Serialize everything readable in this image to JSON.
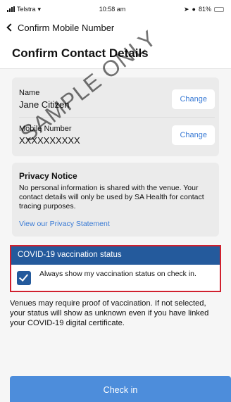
{
  "status_bar": {
    "carrier": "Telstra",
    "time": "10:58 am",
    "battery": "81%",
    "battery_level": 0.81
  },
  "nav": {
    "back_label": "Confirm Mobile Number"
  },
  "header": {
    "title": "Confirm Contact Details"
  },
  "contact": {
    "name_label": "Name",
    "name_value": "Jane Citizen",
    "mobile_label": "Mobile Number",
    "mobile_value": "XXXXXXXXXX",
    "change_label": "Change"
  },
  "privacy": {
    "title": "Privacy Notice",
    "text": "No personal information is shared with the venue. Your contact details will only be used by SA Health for contact tracing purposes.",
    "link": "View our Privacy Statement"
  },
  "vaccination": {
    "header": "COVID-19 vaccination status",
    "checkbox_label": "Always show my vaccination status on check in.",
    "checked": true
  },
  "info": {
    "text": "Venues may require proof of vaccination. If not selected, your status will show as unknown even if you have linked your COVID-19 digital certificate."
  },
  "checkin": {
    "label": "Check in"
  },
  "watermark": {
    "text": "SAMPLE ONLY"
  },
  "colors": {
    "accent_blue": "#245a9c",
    "button_blue": "#4d8ddb",
    "link_blue": "#3a7bd5",
    "highlight_red": "#d0202e"
  }
}
